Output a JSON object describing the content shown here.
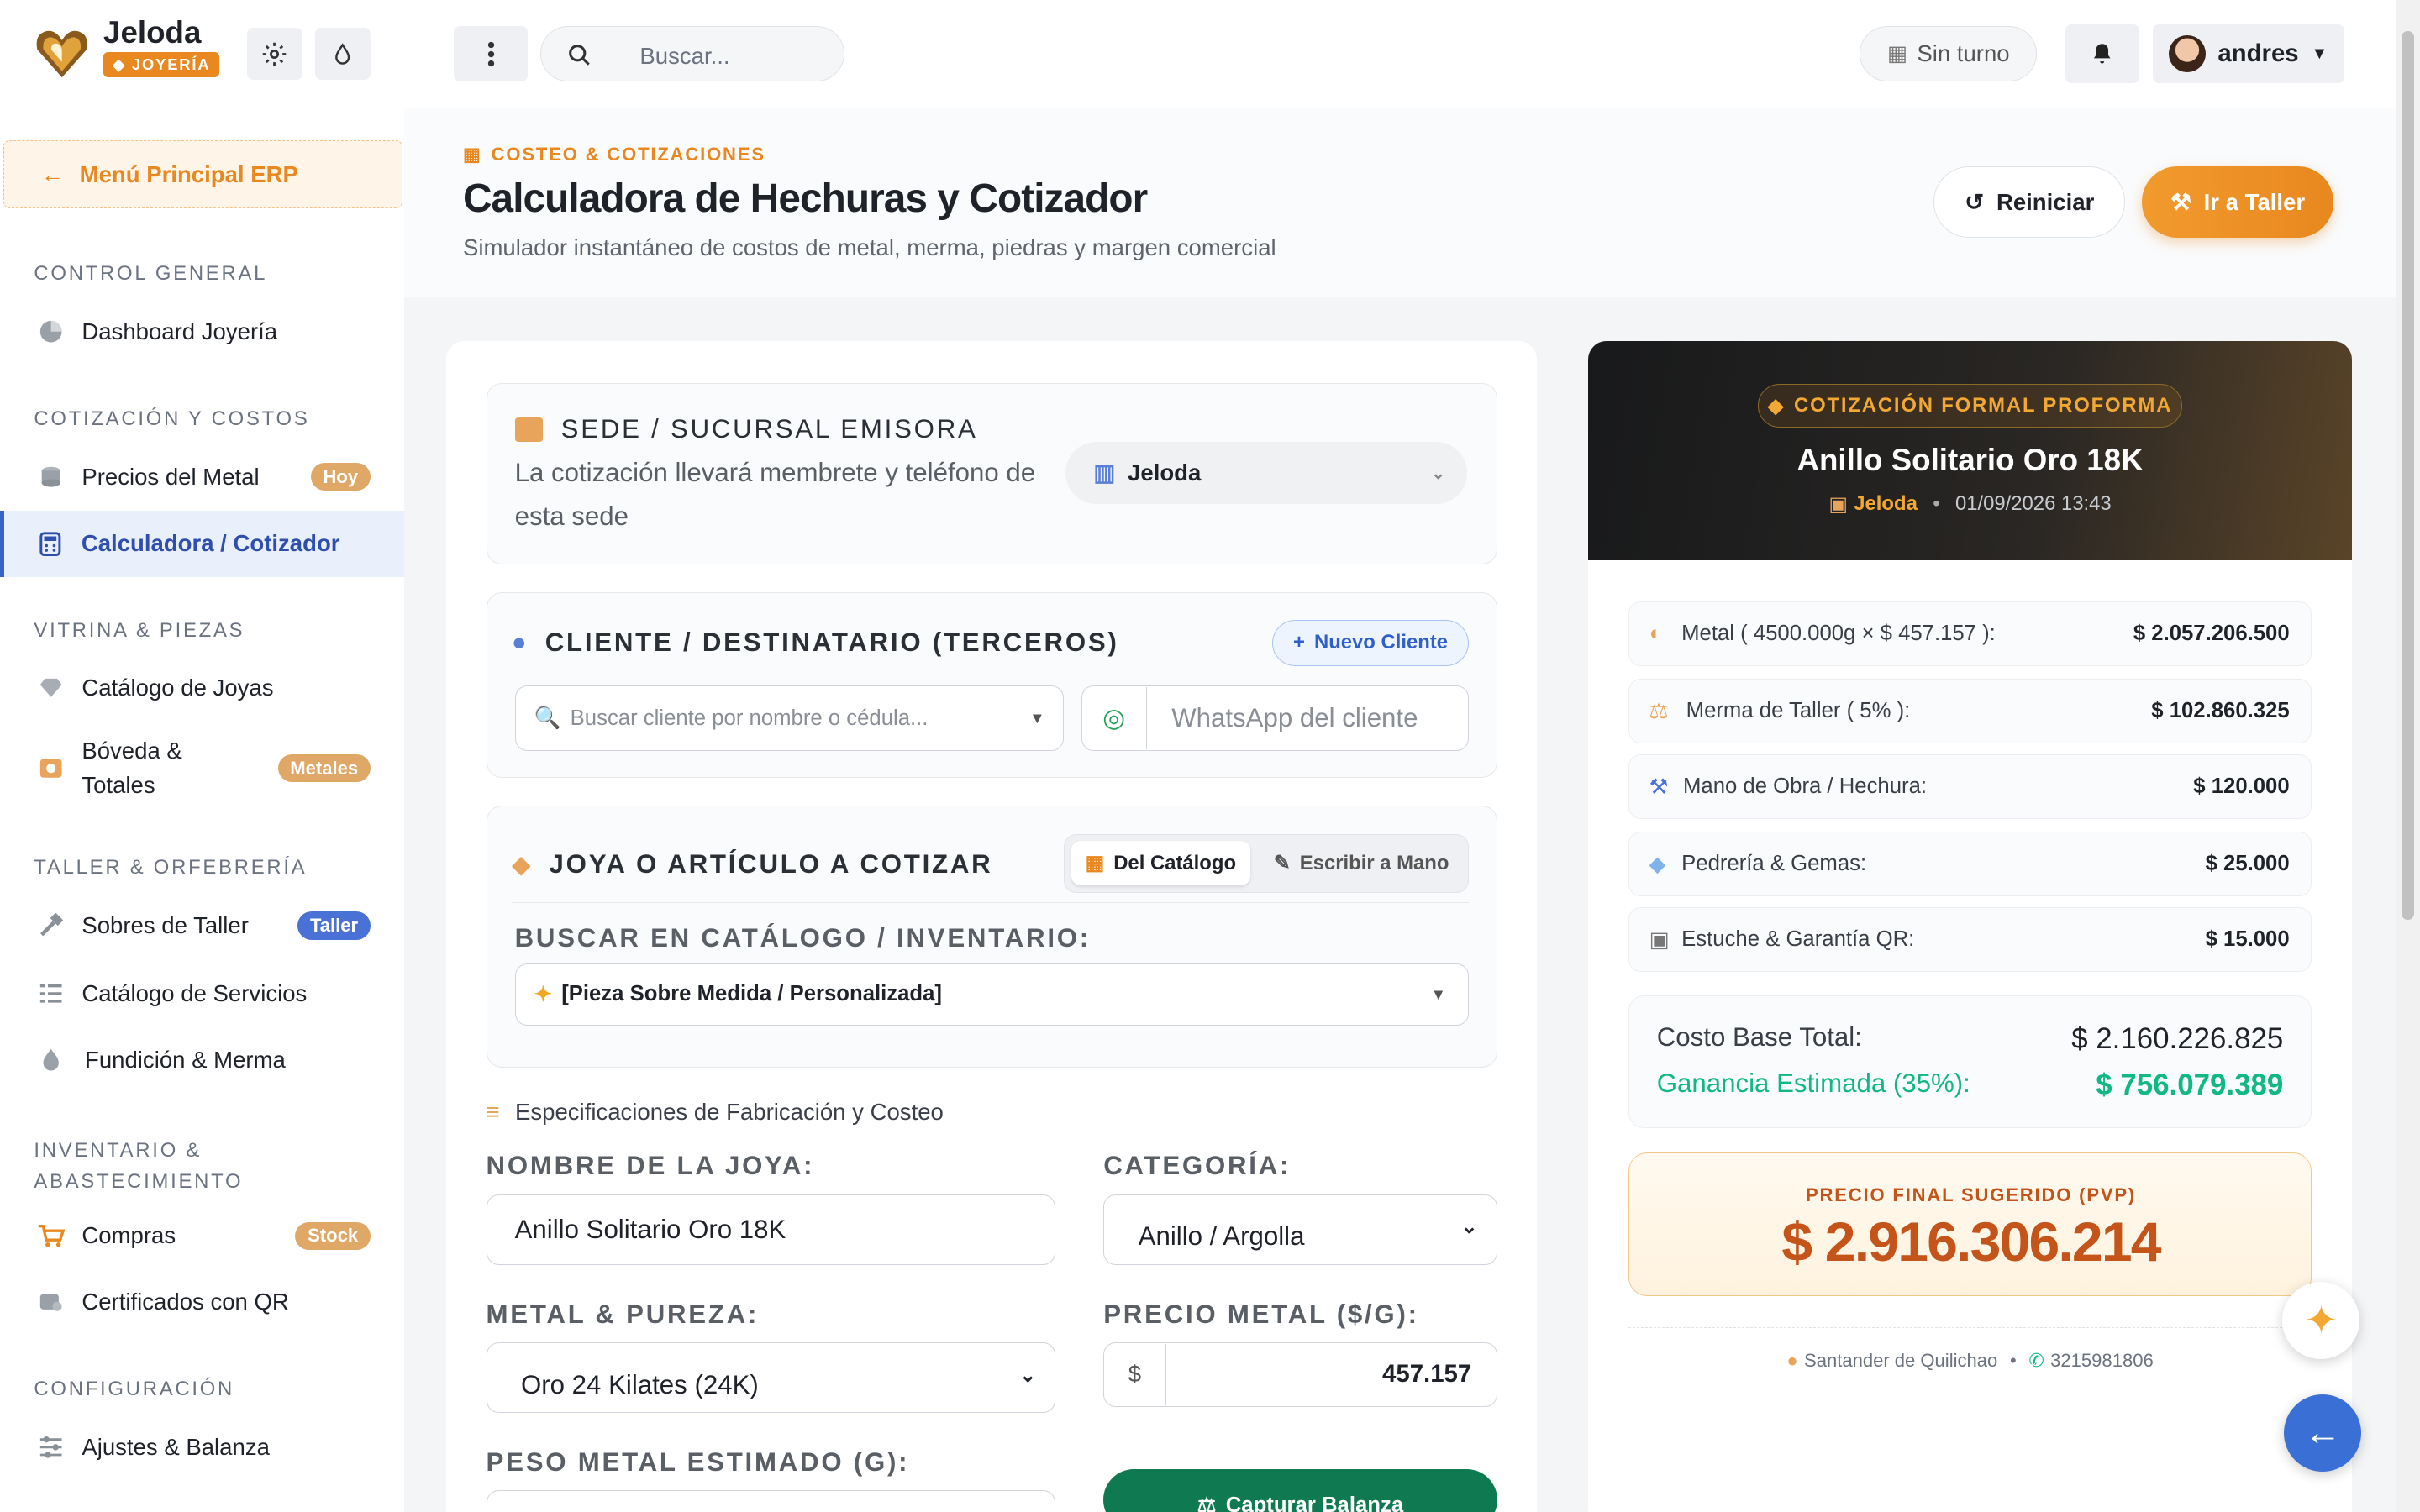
{
  "topbar": {
    "brand": "Jeloda",
    "brand_badge": "JOYERÍA",
    "search_placeholder": "Buscar...",
    "shift": "Sin turno",
    "user": "andres"
  },
  "sidebar": {
    "back": "Menú Principal ERP",
    "sections": [
      {
        "title": "CONTROL GENERAL",
        "items": [
          {
            "label": "Dashboard Joyería"
          }
        ]
      },
      {
        "title": "COTIZACIÓN Y COSTOS",
        "items": [
          {
            "label": "Precios del Metal",
            "badge": "Hoy"
          },
          {
            "label": "Calculadora / Cotizador"
          }
        ]
      },
      {
        "title": "VITRINA & PIEZAS",
        "items": [
          {
            "label": "Catálogo de Joyas"
          },
          {
            "label": "Bóveda & Totales",
            "badge": "Metales"
          }
        ]
      },
      {
        "title": "TALLER & ORFEBRERÍA",
        "items": [
          {
            "label": "Sobres de Taller",
            "badge": "Taller"
          },
          {
            "label": "Catálogo de Servicios"
          },
          {
            "label": "Fundición & Merma"
          }
        ]
      },
      {
        "title": "INVENTARIO & ABASTECIMIENTO",
        "items": [
          {
            "label": "Compras",
            "badge": "Stock"
          },
          {
            "label": "Certificados con QR"
          }
        ]
      },
      {
        "title": "CONFIGURACIÓN",
        "items": [
          {
            "label": "Ajustes & Balanza"
          }
        ]
      }
    ]
  },
  "header": {
    "eyebrow": "COSTEO & COTIZACIONES",
    "title": "Calculadora de Hechuras y Cotizador",
    "subtitle": "Simulador instantáneo de costos de metal, merma, piedras y margen comercial",
    "reset": "Reiniciar",
    "workshop": "Ir a Taller"
  },
  "form": {
    "branch_title": "SEDE / SUCURSAL EMISORA",
    "branch_desc": "La cotización llevará membrete y teléfono de esta sede",
    "branch_value": "Jeloda",
    "client_title": "CLIENTE / DESTINATARIO (TERCEROS)",
    "new_client": "Nuevo Cliente",
    "client_placeholder": "Buscar cliente por nombre o cédula...",
    "whatsapp_placeholder": "WhatsApp del cliente",
    "jewel_title": "JOYA O ARTÍCULO A COTIZAR",
    "tab_catalog": "Del Catálogo",
    "tab_manual": "Escribir a Mano",
    "search_catalog_label": "BUSCAR EN CATÁLOGO / INVENTARIO:",
    "catalog_value": "[Pieza Sobre Medida / Personalizada]",
    "specs_title": "Especificaciones de Fabricación y Costeo",
    "name_label": "NOMBRE DE LA JOYA:",
    "name_value": "Anillo Solitario Oro 18K",
    "category_label": "CATEGORÍA:",
    "category_value": "Anillo / Argolla",
    "metal_label": "METAL & PUREZA:",
    "metal_value": "Oro 24 Kilates (24K)",
    "price_label": "PRECIO METAL ($/G):",
    "price_prefix": "$",
    "price_value": "457.157",
    "weight_label": "PESO METAL ESTIMADO (G):",
    "scale_button": "Capturar Balanza"
  },
  "quote": {
    "badge": "COTIZACIÓN FORMAL PROFORMA",
    "title": "Anillo Solitario Oro 18K",
    "branch": "Jeloda",
    "sep": "•",
    "date": "01/09/2026 13:43",
    "lines": [
      {
        "label": "Metal ( 4500.000g × $ 457.157 ):",
        "value": "$ 2.057.206.500",
        "icon": "coins-icon"
      },
      {
        "label": "Merma de Taller ( 5% ):",
        "value": "$ 102.860.325",
        "icon": "scale-icon"
      },
      {
        "label": "Mano de Obra / Hechura:",
        "value": "$ 120.000",
        "icon": "hammer-icon"
      },
      {
        "label": "Pedrería & Gemas:",
        "value": "$ 25.000",
        "icon": "gem-icon"
      },
      {
        "label": "Estuche & Garantía QR:",
        "value": "$ 15.000",
        "icon": "box-icon"
      }
    ],
    "base_label": "Costo Base Total:",
    "base_value": "$ 2.160.226.825",
    "profit_label": "Ganancia Estimada (35%):",
    "profit_value": "$ 756.079.389",
    "final_label": "PRECIO FINAL SUGERIDO (PVP)",
    "final_value": "$ 2.916.306.214",
    "location": "Santander de Quilichao",
    "phone": "3215981806"
  },
  "colors": {
    "accent": "#e8881f",
    "primary": "#2f4fae",
    "green": "#10b981",
    "dark": "#1c1c1e"
  }
}
